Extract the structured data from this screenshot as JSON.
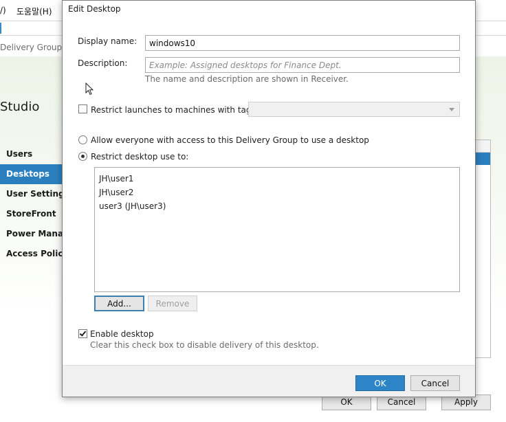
{
  "background_window": {
    "menu_partial": "/)",
    "menu_help": "도움말(H)",
    "breadcrumb_partial": "Delivery Group",
    "studio_title_partial": "Studio",
    "nav_items": [
      {
        "label": "Users",
        "active": false
      },
      {
        "label": "Desktops",
        "active": true
      },
      {
        "label": "User Settings",
        "active": false
      },
      {
        "label": "StoreFront",
        "active": false
      },
      {
        "label": "Power Management",
        "active": false
      },
      {
        "label": "Access Policy",
        "active": false
      }
    ],
    "buttons": {
      "ok": "OK",
      "cancel": "Cancel",
      "apply": "Apply"
    }
  },
  "dialog": {
    "title": "Edit Desktop",
    "display_name_label": "Display name:",
    "display_name_value": "windows10",
    "description_label": "Description:",
    "description_placeholder": "Example: Assigned desktops for Finance Dept.",
    "description_value": "",
    "hint": "The name and description are shown in Receiver.",
    "restrict_tag_label": "Restrict launches to machines with tag:",
    "restrict_tag_checked": false,
    "tag_selected": "",
    "radio_allow_everyone": "Allow everyone with access to this Delivery Group to use a desktop",
    "radio_restrict": "Restrict desktop use to:",
    "selected_radio": "restrict",
    "users": [
      "JH\\user1",
      "JH\\user2",
      "user3 (JH\\user3)"
    ],
    "add_button": "Add...",
    "remove_button": "Remove",
    "enable_desktop_label": "Enable desktop",
    "enable_desktop_checked": true,
    "enable_desktop_sub": "Clear this check box to disable delivery of this desktop.",
    "ok_button": "OK",
    "cancel_button": "Cancel"
  },
  "colors": {
    "accent": "#2c7fbf",
    "primary_button": "#2d84c6",
    "hint_text": "#6b6b6b"
  },
  "icons": {
    "mouse_pointer": "mouse-pointer-icon",
    "combo_arrow": "chevron-down-icon"
  }
}
